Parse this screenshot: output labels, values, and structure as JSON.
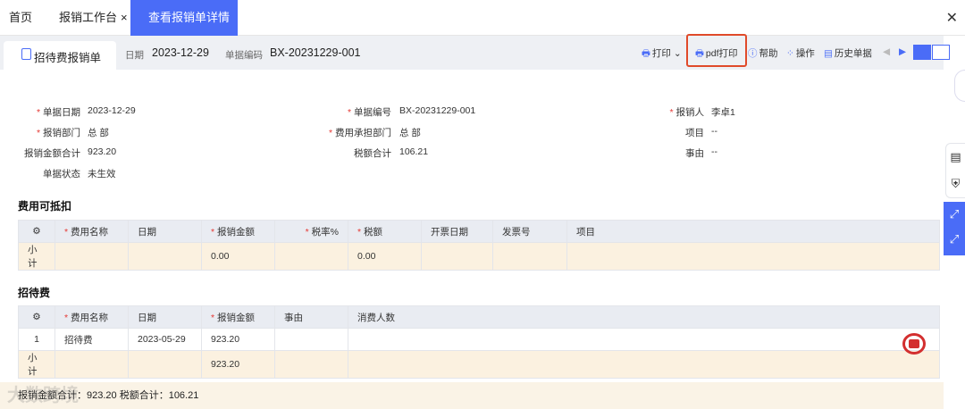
{
  "tabs": [
    {
      "label": "首页",
      "closable": false
    },
    {
      "label": "报销工作台",
      "closable": true
    },
    {
      "label": "查看报销单详情",
      "closable": true,
      "active": true
    }
  ],
  "close_all_label": "✕",
  "header": {
    "doc_tab_label": "招待费报销单",
    "date_label": "日期",
    "date_value": "2023-12-29",
    "code_label": "单据编码",
    "code_value": "BX-20231229-001"
  },
  "toolbar": {
    "print": "打印",
    "pdf_print": "pdf打印",
    "help": "帮助",
    "operate": "操作",
    "history": "历史单据"
  },
  "form": {
    "doc_date_label": "单据日期",
    "doc_date": "2023-12-29",
    "doc_no_label": "单据编号",
    "doc_no": "BX-20231229-001",
    "claimant_label": "报销人",
    "claimant": "李卓1",
    "dept_label": "报销部门",
    "dept": "总 部",
    "cost_dept_label": "费用承担部门",
    "cost_dept": "总 部",
    "project_label": "项目",
    "project": "--",
    "amount_total_label": "报销金额合计",
    "amount_total": "923.20",
    "tax_total_label": "税额合计",
    "tax_total": "106.21",
    "reason_label": "事由",
    "reason": "--",
    "status_label": "单据状态",
    "status": "未生效"
  },
  "deductible": {
    "title": "费用可抵扣",
    "headers": [
      "费用名称",
      "日期",
      "报销金额",
      "税率%",
      "税额",
      "开票日期",
      "发票号",
      "项目"
    ],
    "subtotal_label": "小计",
    "subtotal_amount": "0.00",
    "subtotal_tax": "0.00"
  },
  "entertainment": {
    "title": "招待费",
    "headers": [
      "费用名称",
      "日期",
      "报销金额",
      "事由",
      "消费人数"
    ],
    "rows": [
      {
        "no": "1",
        "name": "招待费",
        "date": "2023-05-29",
        "amount": "923.20",
        "reason": "",
        "people": ""
      }
    ],
    "subtotal_label": "小计",
    "subtotal_amount": "923.20"
  },
  "footer": {
    "text": "报销金额合计：923.20  税额合计：106.21",
    "watermark": "大数跨境"
  },
  "colors": {
    "accent": "#4a6cf7",
    "highlight": "#e04a2a",
    "subtotal_bg": "#fbf1e0"
  }
}
